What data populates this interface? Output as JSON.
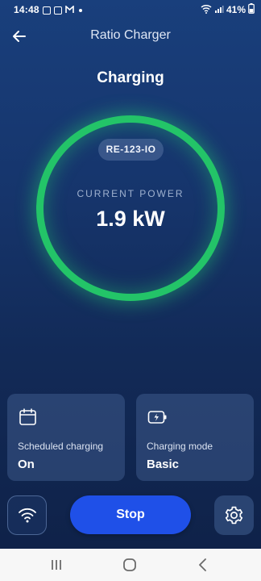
{
  "status_bar": {
    "time": "14:48",
    "notification_icons": [
      "image-icon",
      "cast-icon",
      "mail-icon"
    ],
    "battery": "41%"
  },
  "header": {
    "title": "Ratio Charger",
    "back_icon": "arrow-left-icon"
  },
  "charging": {
    "status": "Charging",
    "charger_id": "RE-123-IO",
    "power_label": "CURRENT POWER",
    "power_value": "1.9 kW",
    "ring_color": "#23c468"
  },
  "cards": {
    "scheduled": {
      "icon": "calendar-icon",
      "label": "Scheduled charging",
      "value": "On"
    },
    "mode": {
      "icon": "battery-charging-icon",
      "label": "Charging mode",
      "value": "Basic"
    }
  },
  "controls": {
    "wifi_icon": "wifi-icon",
    "stop_label": "Stop",
    "stop_color": "#1f50e8",
    "settings_icon": "gear-icon"
  },
  "navbar": {
    "buttons": [
      "recents-icon",
      "home-icon",
      "back-icon"
    ]
  }
}
